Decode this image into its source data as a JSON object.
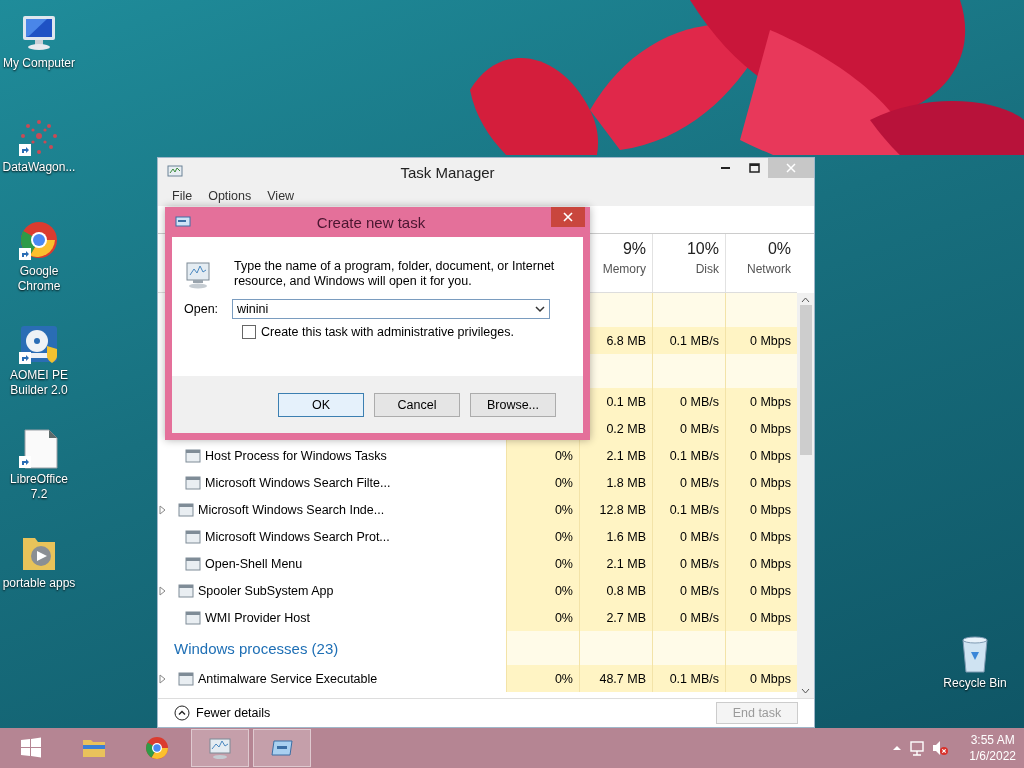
{
  "desktop_icons": [
    {
      "label": "My Computer",
      "kind": "computer",
      "shortcut": false
    },
    {
      "label": "DataWagon...",
      "kind": "dots",
      "shortcut": true
    },
    {
      "label": "Google Chrome",
      "kind": "browser",
      "shortcut": true
    },
    {
      "label": "AOMEI PE Builder 2.0",
      "kind": "disc",
      "shortcut": true
    },
    {
      "label": "LibreOffice 7.2",
      "kind": "document",
      "shortcut": true
    },
    {
      "label": "portable apps",
      "kind": "folder",
      "shortcut": false
    }
  ],
  "recycle_bin": {
    "label": "Recycle Bin"
  },
  "task_manager": {
    "title": "Task Manager",
    "menu": [
      "File",
      "Options",
      "View"
    ],
    "columns": [
      {
        "usage": "9%",
        "label": "Memory"
      },
      {
        "usage": "10%",
        "label": "Disk"
      },
      {
        "usage": "0%",
        "label": "Network"
      }
    ],
    "rows": [
      {
        "kind": "group"
      },
      {
        "kind": "process",
        "memory": "6.8 MB",
        "disk": "0.1 MB/s",
        "network": "0 Mbps"
      },
      {
        "kind": "group"
      },
      {
        "kind": "process",
        "memory": "0.1 MB",
        "disk": "0 MB/s",
        "network": "0 Mbps"
      },
      {
        "kind": "process",
        "memory": "0.2 MB",
        "disk": "0 MB/s",
        "network": "0 Mbps"
      },
      {
        "kind": "process",
        "expandable": false,
        "name": "Host Process for Windows Tasks",
        "cpu": "0%",
        "memory": "2.1 MB",
        "disk": "0.1 MB/s",
        "network": "0 Mbps"
      },
      {
        "kind": "process",
        "expandable": false,
        "name": "Microsoft Windows Search Filte...",
        "cpu": "0%",
        "memory": "1.8 MB",
        "disk": "0 MB/s",
        "network": "0 Mbps"
      },
      {
        "kind": "process",
        "expandable": true,
        "name": "Microsoft Windows Search Inde...",
        "cpu": "0%",
        "memory": "12.8 MB",
        "disk": "0.1 MB/s",
        "network": "0 Mbps"
      },
      {
        "kind": "process",
        "expandable": false,
        "name": "Microsoft Windows Search Prot...",
        "cpu": "0%",
        "memory": "1.6 MB",
        "disk": "0 MB/s",
        "network": "0 Mbps"
      },
      {
        "kind": "process",
        "expandable": false,
        "name": "Open-Shell Menu",
        "cpu": "0%",
        "memory": "2.1 MB",
        "disk": "0 MB/s",
        "network": "0 Mbps"
      },
      {
        "kind": "process",
        "expandable": true,
        "name": "Spooler SubSystem App",
        "cpu": "0%",
        "memory": "0.8 MB",
        "disk": "0 MB/s",
        "network": "0 Mbps"
      },
      {
        "kind": "process",
        "expandable": false,
        "name": "WMI Provider Host",
        "cpu": "0%",
        "memory": "2.7 MB",
        "disk": "0 MB/s",
        "network": "0 Mbps"
      },
      {
        "kind": "group",
        "title": "Windows processes (23)"
      },
      {
        "kind": "process",
        "expandable": true,
        "name": "Antimalware Service Executable",
        "cpu": "0%",
        "memory": "48.7 MB",
        "disk": "0.1 MB/s",
        "network": "0 Mbps"
      }
    ],
    "fewer_details": "Fewer details",
    "end_task": {
      "label": "End task",
      "disabled": true
    }
  },
  "dialog": {
    "title": "Create new task",
    "message": "Type the name of a program, folder, document, or Internet resource, and Windows will open it for you.",
    "open_label": "Open:",
    "value": "winini",
    "checkbox": {
      "label": "Create this task with administrative privileges.",
      "checked": false
    },
    "buttons": [
      {
        "label": "OK",
        "default": true
      },
      {
        "label": "Cancel",
        "default": false
      },
      {
        "label": "Browse...",
        "default": false
      }
    ]
  },
  "taskbar": {
    "items": [
      {
        "kind": "start",
        "active": false
      },
      {
        "kind": "explorer",
        "active": false
      },
      {
        "kind": "browser",
        "active": false
      },
      {
        "kind": "monitor",
        "active": true
      },
      {
        "kind": "dialog",
        "active": true
      }
    ],
    "muted": true,
    "time": "3:55 AM",
    "date": "1/6/2022"
  }
}
